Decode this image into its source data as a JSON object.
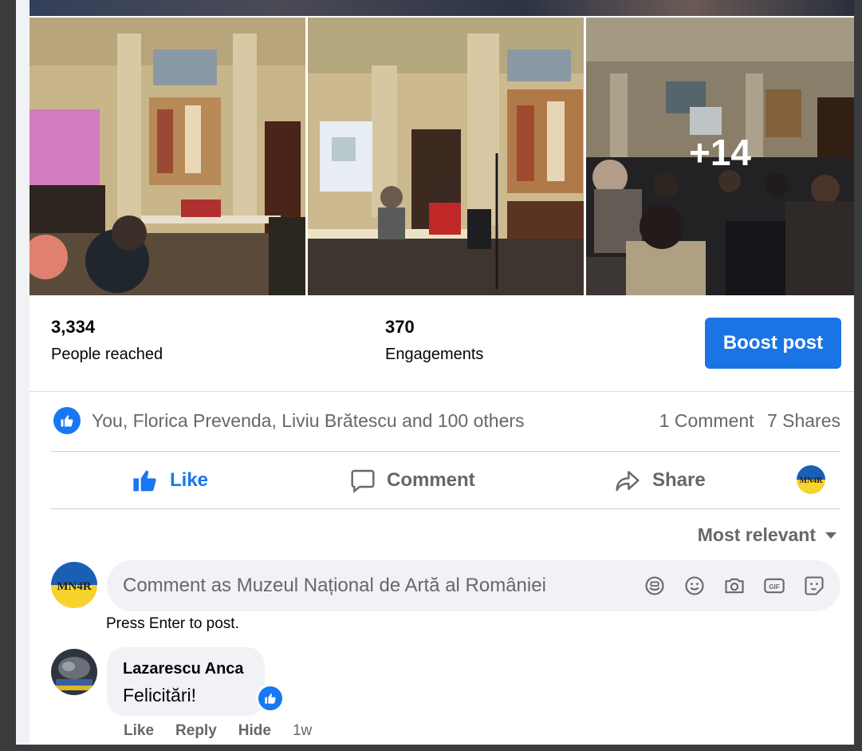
{
  "photos": {
    "more_count": "+14"
  },
  "stats": {
    "reached_value": "3,334",
    "reached_label": "People reached",
    "engagements_value": "370",
    "engagements_label": "Engagements",
    "boost_label": "Boost post"
  },
  "reactions": {
    "summary": "You, Florica Prevenda, Liviu Brătescu and 100 others",
    "comments": "1 Comment",
    "shares": "7 Shares"
  },
  "actions": {
    "like": "Like",
    "comment": "Comment",
    "share": "Share"
  },
  "sort": {
    "label": "Most relevant"
  },
  "composer": {
    "placeholder": "Comment as Muzeul Național de Artă al României",
    "hint": "Press Enter to post."
  },
  "comment": {
    "author": "Lazarescu Anca",
    "text": "Felicitări!",
    "like": "Like",
    "reply": "Reply",
    "hide": "Hide",
    "time": "1w"
  },
  "icons": {
    "like": "thumbs-up-icon",
    "comment": "speech-bubble-icon",
    "share": "share-arrow-icon",
    "sticker": "sticker-icon",
    "emoji": "smiley-icon",
    "camera": "camera-icon",
    "gif": "gif-icon",
    "avatar_sticker": "avatar-sticker-icon"
  },
  "colors": {
    "accent": "#1877f2",
    "boost": "#1b74e4",
    "muted": "#65676b"
  }
}
